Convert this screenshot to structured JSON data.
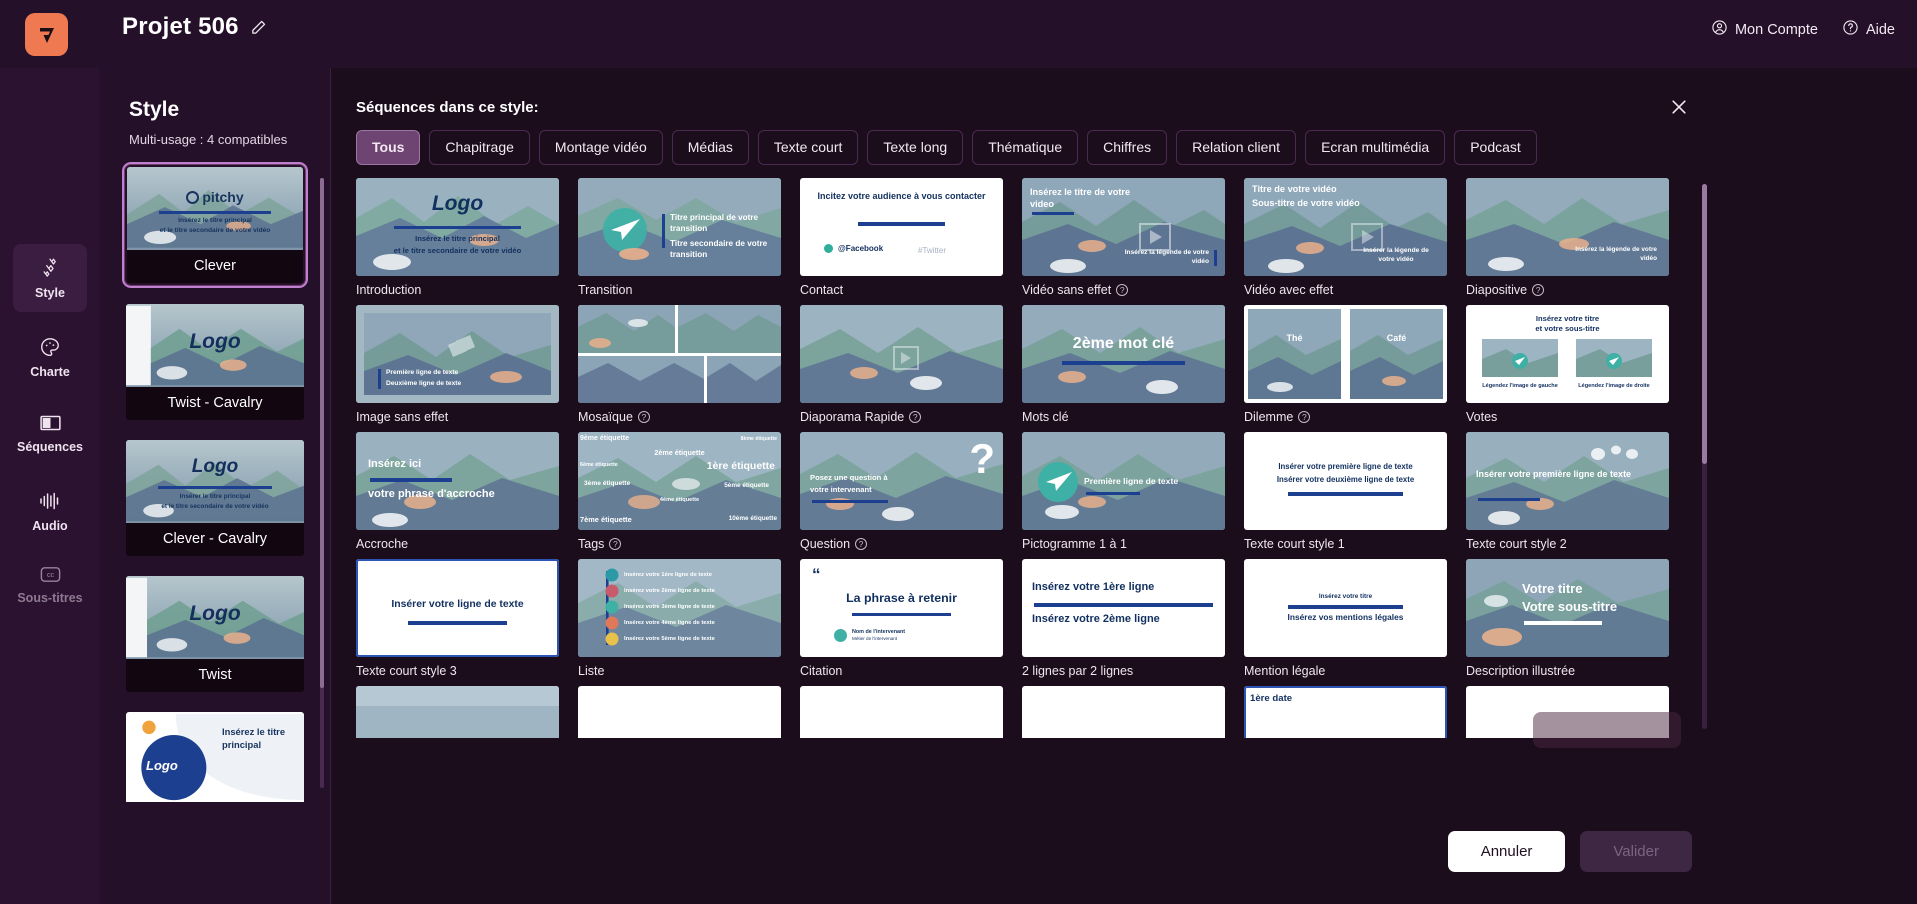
{
  "topbar": {
    "project_title": "Projet 506",
    "edit_icon": "pencil-icon",
    "account_label": "Mon Compte",
    "account_icon": "user-circle-icon",
    "help_label": "Aide",
    "help_icon": "question-circle-icon",
    "logo_icon": "pitchy-logo-icon",
    "accent_color": "#ef7a52",
    "bar_color": "#241028"
  },
  "rail": {
    "items": [
      {
        "label": "Style",
        "icon": "sparkles-icon",
        "active": true,
        "dim": false
      },
      {
        "label": "Charte",
        "icon": "palette-icon",
        "active": false,
        "dim": false
      },
      {
        "label": "Séquences",
        "icon": "layout-icon",
        "active": false,
        "dim": false
      },
      {
        "label": "Audio",
        "icon": "waveform-icon",
        "active": false,
        "dim": false
      },
      {
        "label": "Sous-titres",
        "icon": "cc-icon",
        "active": false,
        "dim": true
      }
    ]
  },
  "style_panel": {
    "heading": "Style",
    "subtitle": "Multi-usage : 4 compatibles",
    "styles": [
      {
        "name": "Clever",
        "selected": true,
        "thumb_logo": "pitchy",
        "line1": "Insérez le titre principal",
        "line2": "et le titre secondaire de votre vidéo"
      },
      {
        "name": "Twist - Cavalry",
        "selected": false,
        "thumb_logo": "Logo",
        "line1": "",
        "line2": ""
      },
      {
        "name": "Clever - Cavalry",
        "selected": false,
        "thumb_logo": "Logo",
        "line1": "Insérer le titre principal",
        "line2": "et le titre secondaire de votre vidéo"
      },
      {
        "name": "Twist",
        "selected": false,
        "thumb_logo": "Logo",
        "line1": "",
        "line2": ""
      },
      {
        "name": "",
        "selected": false,
        "thumb_logo": "Logo",
        "line1": "Insérez le titre principal",
        "line2": ""
      }
    ]
  },
  "modal": {
    "title": "Séquences dans ce style:",
    "close_icon": "close-icon",
    "chips": [
      {
        "label": "Tous",
        "active": true
      },
      {
        "label": "Chapitrage",
        "active": false
      },
      {
        "label": "Montage vidéo",
        "active": false
      },
      {
        "label": "Médias",
        "active": false
      },
      {
        "label": "Texte court",
        "active": false
      },
      {
        "label": "Texte long",
        "active": false
      },
      {
        "label": "Thématique",
        "active": false
      },
      {
        "label": "Chiffres",
        "active": false
      },
      {
        "label": "Relation client",
        "active": false
      },
      {
        "label": "Ecran multimédia",
        "active": false
      },
      {
        "label": "Podcast",
        "active": false
      }
    ],
    "sequences": [
      {
        "label": "Introduction",
        "info": false,
        "style": "scene",
        "selected": false,
        "texts": [
          {
            "t": "Logo",
            "cls": "logo"
          },
          {
            "t": "Insérez le titre principal",
            "cls": "sub1"
          },
          {
            "t": "et le titre secondaire de votre vidéo",
            "cls": "sub2"
          }
        ]
      },
      {
        "label": "Transition",
        "info": false,
        "style": "scene",
        "selected": false,
        "texts": [
          {
            "t": "Titre principal de votre transition",
            "cls": "rt1"
          },
          {
            "t": "Titre secondaire de votre transition",
            "cls": "rt2"
          }
        ]
      },
      {
        "label": "Contact",
        "info": false,
        "style": "white",
        "selected": false,
        "texts": [
          {
            "t": "Incitez votre audience à vous contacter",
            "cls": "ct"
          },
          {
            "t": "@Facebook",
            "cls": "fb"
          },
          {
            "t": "#Twitter",
            "cls": "tw"
          }
        ]
      },
      {
        "label": "Vidéo sans effet",
        "info": true,
        "style": "scene",
        "selected": false,
        "texts": [
          {
            "t": "Insérez le titre de votre video",
            "cls": "tl"
          },
          {
            "t": "Insérez la légende de votre vidéo",
            "cls": "br"
          }
        ]
      },
      {
        "label": "Vidéo avec effet",
        "info": false,
        "style": "scene",
        "selected": false,
        "texts": [
          {
            "t": "Titre de votre vidéo",
            "cls": "tl"
          },
          {
            "t": "Sous-titre de votre vidéo",
            "cls": "tl2"
          },
          {
            "t": "Insérer la légende de votre vidéo",
            "cls": "br"
          }
        ]
      },
      {
        "label": "Diapositive",
        "info": true,
        "style": "scene",
        "selected": false,
        "texts": [
          {
            "t": "Insérez la légende de votre vidéo",
            "cls": "br"
          }
        ]
      },
      {
        "label": "Image sans effet",
        "info": false,
        "style": "scene",
        "selected": false,
        "texts": [
          {
            "t": "Première ligne de texte",
            "cls": "bl1"
          },
          {
            "t": "Deuxième ligne de texte",
            "cls": "bl2"
          }
        ]
      },
      {
        "label": "Mosaïque",
        "info": true,
        "style": "mosaic",
        "selected": false,
        "texts": []
      },
      {
        "label": "Diaporama Rapide",
        "info": true,
        "style": "scene",
        "selected": false,
        "texts": []
      },
      {
        "label": "Mots clé",
        "info": false,
        "style": "scene",
        "selected": false,
        "texts": [
          {
            "t": "2ème mot clé",
            "cls": "kw"
          }
        ]
      },
      {
        "label": "Dilemme",
        "info": true,
        "style": "split",
        "selected": false,
        "texts": [
          {
            "t": "Thé",
            "cls": "sl"
          },
          {
            "t": "Café",
            "cls": "sr"
          }
        ]
      },
      {
        "label": "Votes",
        "info": false,
        "style": "white",
        "selected": false,
        "texts": [
          {
            "t": "Insérez votre titre",
            "cls": "vt1"
          },
          {
            "t": "et votre sous-titre",
            "cls": "vt2"
          },
          {
            "t": "Légendez l'image de gauche",
            "cls": "vl"
          },
          {
            "t": "Légendez l'image de droite",
            "cls": "vr"
          }
        ]
      },
      {
        "label": "Accroche",
        "info": false,
        "style": "scene",
        "selected": false,
        "texts": [
          {
            "t": "Insérez ici",
            "cls": "ac1"
          },
          {
            "t": "votre phrase d'accroche",
            "cls": "ac2"
          }
        ]
      },
      {
        "label": "Tags",
        "info": true,
        "style": "scene",
        "selected": false,
        "texts": [
          {
            "t": "9ème étiquette",
            "cls": "g1"
          },
          {
            "t": "8ème étiquette",
            "cls": "g2"
          },
          {
            "t": "2ème étiquette",
            "cls": "g3"
          },
          {
            "t": "6ème étiquette",
            "cls": "g4"
          },
          {
            "t": "1ère étiquette",
            "cls": "g5"
          },
          {
            "t": "3ème étiquette",
            "cls": "g6"
          },
          {
            "t": "5ème étiquette",
            "cls": "g7"
          },
          {
            "t": "4ème étiquette",
            "cls": "g8"
          },
          {
            "t": "7ème étiquette",
            "cls": "g9"
          },
          {
            "t": "10ème étiquette",
            "cls": "g10"
          }
        ]
      },
      {
        "label": "Question",
        "info": true,
        "style": "scene",
        "selected": false,
        "texts": [
          {
            "t": "Posez une question à votre intervenant",
            "cls": "q1"
          },
          {
            "t": "?",
            "cls": "qm"
          }
        ]
      },
      {
        "label": "Pictogramme 1 à 1",
        "info": false,
        "style": "scene",
        "selected": false,
        "texts": [
          {
            "t": "Première ligne de texte",
            "cls": "p1"
          }
        ]
      },
      {
        "label": "Texte court style 1",
        "info": false,
        "style": "white",
        "selected": false,
        "texts": [
          {
            "t": "Insérer votre première ligne de texte",
            "cls": "w1"
          },
          {
            "t": "Insérer votre deuxième ligne de texte",
            "cls": "w2"
          }
        ]
      },
      {
        "label": "Texte court style 2",
        "info": false,
        "style": "scene",
        "selected": false,
        "texts": [
          {
            "t": "Insérer votre première ligne de texte",
            "cls": "sc2"
          }
        ]
      },
      {
        "label": "Texte court style 3",
        "info": false,
        "style": "white",
        "selected": true,
        "texts": [
          {
            "t": "Insérer votre ligne de texte",
            "cls": "c3"
          }
        ]
      },
      {
        "label": "Liste",
        "info": false,
        "style": "scene",
        "selected": false,
        "texts": [
          {
            "t": "Insérez votre 1ère ligne de texte",
            "cls": "l1"
          },
          {
            "t": "Insérez votre 2ème ligne de texte",
            "cls": "l2"
          },
          {
            "t": "Insérez votre 3ème ligne de texte",
            "cls": "l3"
          },
          {
            "t": "Insérez votre 4ème ligne de texte",
            "cls": "l4"
          },
          {
            "t": "Insérez votre 5ème ligne de texte",
            "cls": "l5"
          }
        ]
      },
      {
        "label": "Citation",
        "info": false,
        "style": "white",
        "selected": false,
        "texts": [
          {
            "t": "La phrase à retenir",
            "cls": "cit"
          },
          {
            "t": "Nom de l'intervenant",
            "cls": "cn1"
          },
          {
            "t": "Métier de l'intervenant",
            "cls": "cn2"
          }
        ]
      },
      {
        "label": "2 lignes par 2 lignes",
        "info": false,
        "style": "white",
        "selected": false,
        "texts": [
          {
            "t": "Insérez votre 1ère ligne",
            "cls": "d1"
          },
          {
            "t": "Insérez votre 2ème ligne",
            "cls": "d2"
          }
        ]
      },
      {
        "label": "Mention légale",
        "info": false,
        "style": "white",
        "selected": false,
        "texts": [
          {
            "t": "Insérez votre titre",
            "cls": "m1"
          },
          {
            "t": "Insérez vos mentions légales",
            "cls": "m2"
          }
        ]
      },
      {
        "label": "Description illustrée",
        "info": false,
        "style": "scene",
        "selected": false,
        "texts": [
          {
            "t": "Votre titre",
            "cls": "di1"
          },
          {
            "t": "Votre sous-titre",
            "cls": "di2"
          }
        ]
      },
      {
        "label": "",
        "info": false,
        "style": "scene",
        "selected": false,
        "texts": []
      },
      {
        "label": "",
        "info": false,
        "style": "white",
        "selected": false,
        "texts": []
      },
      {
        "label": "",
        "info": false,
        "style": "white",
        "selected": false,
        "texts": []
      },
      {
        "label": "",
        "info": false,
        "style": "white",
        "selected": false,
        "texts": []
      },
      {
        "label": "",
        "info": false,
        "style": "white",
        "selected": true,
        "texts": [
          {
            "t": "1ère date",
            "cls": "dt"
          }
        ]
      },
      {
        "label": "",
        "info": false,
        "style": "white",
        "selected": false,
        "texts": []
      }
    ],
    "cancel_label": "Annuler",
    "validate_label": "Valider"
  }
}
